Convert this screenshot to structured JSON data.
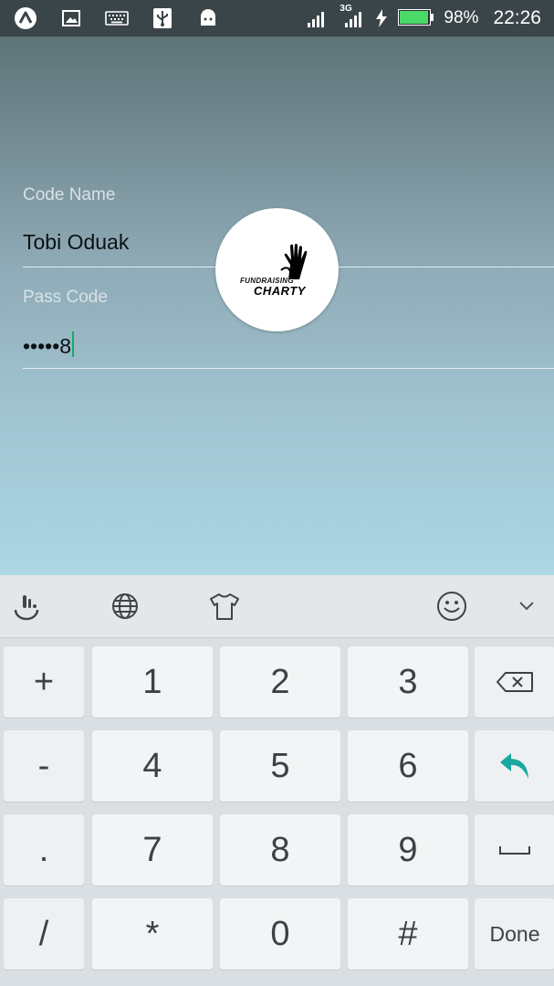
{
  "status_bar": {
    "left_icons": [
      "app-launcher-icon",
      "image-icon",
      "keyboard-icon",
      "usb-icon",
      "android-debug-icon"
    ],
    "network_label": "3G",
    "battery_percent": "98%",
    "battery_level": 0.98,
    "time": "22:26"
  },
  "form": {
    "code_name": {
      "label": "Code Name",
      "value": "Tobi Oduak"
    },
    "pass_code": {
      "label": "Pass Code",
      "value": "•••••8"
    }
  },
  "logo": {
    "line1": "FUNDRAISING",
    "line2": "CHARTY",
    "icon": "raised-hands-icon"
  },
  "keyboard": {
    "toolbar": [
      "touchpal-icon",
      "globe-icon",
      "tshirt-icon",
      "smiley-icon",
      "chevron-down-icon"
    ],
    "rows": [
      [
        "+",
        "1",
        "2",
        "3",
        "backspace"
      ],
      [
        "-",
        "4",
        "5",
        "6",
        "enter"
      ],
      [
        ".",
        "7",
        "8",
        "9",
        "space"
      ],
      [
        "/",
        "*",
        "0",
        "#",
        "Done"
      ]
    ],
    "keys": {
      "r0": {
        "c0": "+",
        "c1": "1",
        "c2": "2",
        "c3": "3"
      },
      "r1": {
        "c0": "-",
        "c1": "4",
        "c2": "5",
        "c3": "6"
      },
      "r2": {
        "c0": ".",
        "c1": "7",
        "c2": "8",
        "c3": "9"
      },
      "r3": {
        "c0": "/",
        "c1": "*",
        "c2": "0",
        "c3": "#",
        "c4": "Done"
      }
    },
    "accent_color": "#1aa7a0"
  }
}
